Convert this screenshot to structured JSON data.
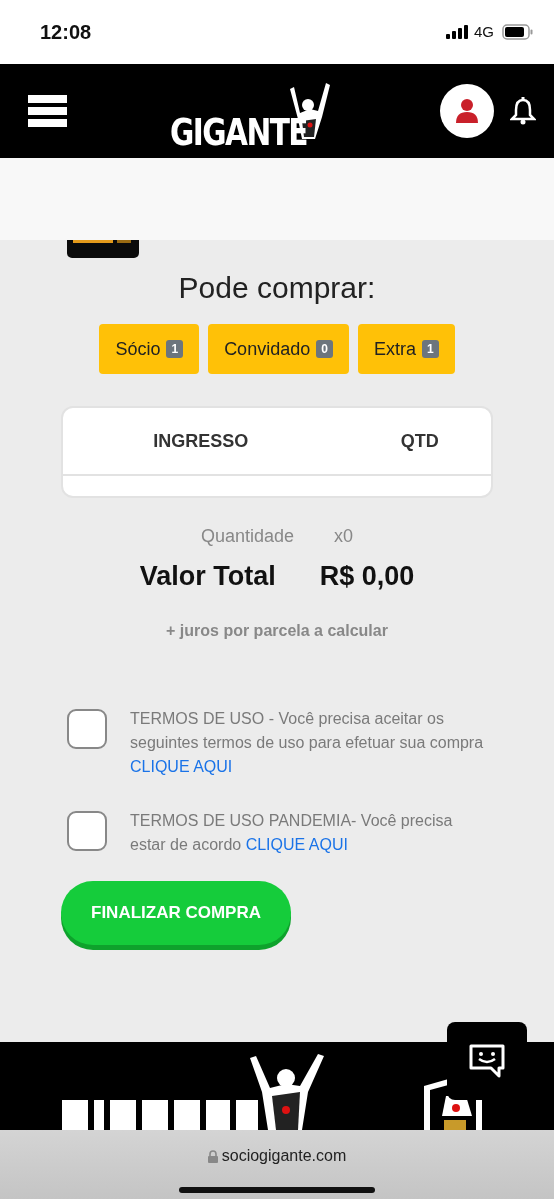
{
  "status_bar": {
    "time": "12:08",
    "network": "4G"
  },
  "header": {
    "logo": "GIGANTE"
  },
  "page": {
    "title": "Pode comprar:",
    "quotas": [
      {
        "label": "Sócio",
        "count": "1"
      },
      {
        "label": "Convidado",
        "count": "0"
      },
      {
        "label": "Extra",
        "count": "1"
      }
    ],
    "table": {
      "columns": [
        "INGRESSO",
        "QTD"
      ]
    },
    "summary": {
      "quantity_label": "Quantidade",
      "quantity": "x0",
      "total_label": "Valor Total",
      "total": "R$ 0,00",
      "note": "+ juros por parcela a calcular"
    },
    "terms": [
      {
        "text": "TERMOS DE USO - Você precisa aceitar os seguintes termos de uso para efetuar sua compra",
        "link": "CLIQUE AQUI",
        "checked": false
      },
      {
        "text": "TERMOS DE USO PANDEMIA- Você precisa estar de acordo",
        "link": "CLIQUE AQUI",
        "checked": false
      }
    ],
    "submit": "FINALIZAR COMPRA"
  },
  "browser": {
    "url": "sociogigante.com"
  }
}
